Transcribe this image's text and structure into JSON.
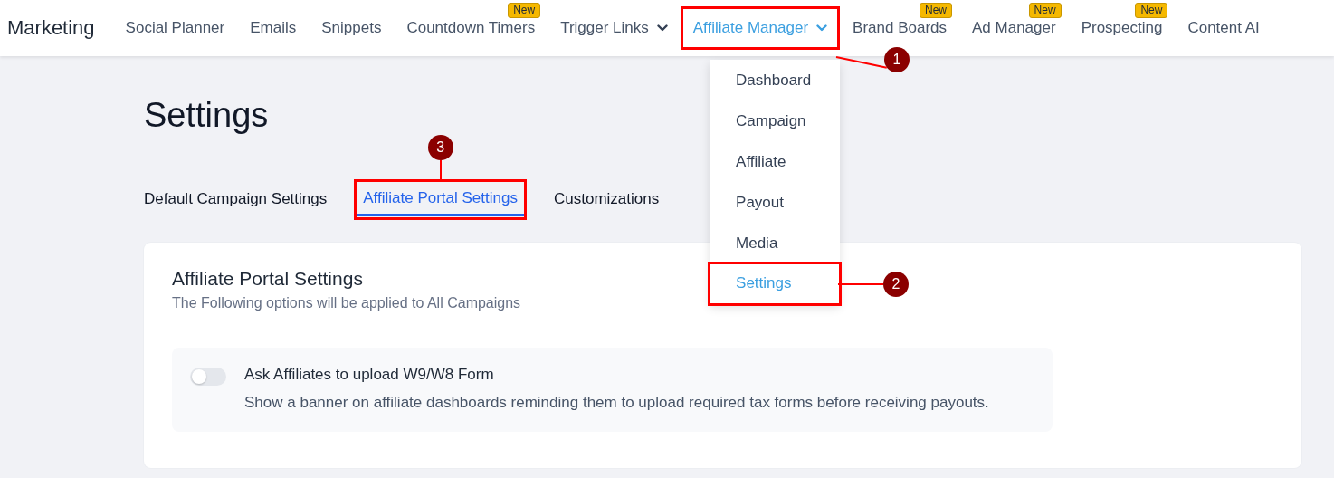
{
  "nav": {
    "brand": "Marketing",
    "items": [
      {
        "label": "Social Planner",
        "dropdown": false,
        "selected": false
      },
      {
        "label": "Emails",
        "dropdown": false,
        "selected": false
      },
      {
        "label": "Snippets",
        "dropdown": false,
        "selected": false
      },
      {
        "label": "Countdown Timers",
        "badge": "New",
        "dropdown": false,
        "selected": false
      },
      {
        "label": "Trigger Links",
        "dropdown": true,
        "selected": false
      },
      {
        "label": "Affiliate Manager",
        "dropdown": true,
        "selected": true,
        "callout": "1",
        "menu": [
          {
            "label": "Dashboard",
            "selected": false
          },
          {
            "label": "Campaign",
            "selected": false
          },
          {
            "label": "Affiliate",
            "selected": false
          },
          {
            "label": "Payout",
            "selected": false
          },
          {
            "label": "Media",
            "selected": false
          },
          {
            "label": "Settings",
            "selected": true,
            "callout": "2"
          }
        ]
      },
      {
        "label": "Brand Boards",
        "badge": "New",
        "dropdown": false,
        "selected": false
      },
      {
        "label": "Ad Manager",
        "badge": "New",
        "dropdown": false,
        "selected": false
      },
      {
        "label": "Prospecting",
        "badge": "New",
        "dropdown": false,
        "selected": false
      },
      {
        "label": "Content AI",
        "dropdown": false,
        "selected": false
      }
    ]
  },
  "page": {
    "title": "Settings",
    "tabs": [
      {
        "label": "Default Campaign Settings",
        "selected": false
      },
      {
        "label": "Affiliate Portal Settings",
        "selected": true,
        "callout": "3"
      },
      {
        "label": "Customizations",
        "selected": false
      }
    ],
    "card": {
      "title": "Affiliate Portal Settings",
      "subtitle": "The Following options will be applied to All Campaigns",
      "options": [
        {
          "title": "Ask Affiliates to upload W9/W8 Form",
          "description": "Show a banner on affiliate dashboards reminding them to upload required tax forms before receiving payouts.",
          "on": false
        }
      ]
    }
  }
}
